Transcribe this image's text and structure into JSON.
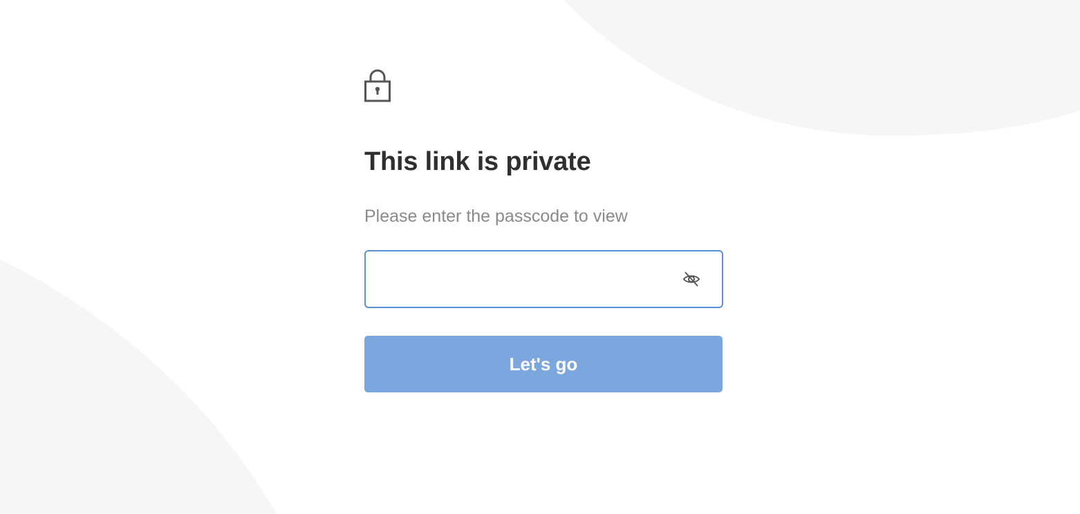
{
  "icons": {
    "lock": "lock-icon",
    "eye_toggle": "eye-slash-icon"
  },
  "colors": {
    "background": "#ffffff",
    "decor_shape": "#f6f6f6",
    "title": "#2f2f2f",
    "subtitle": "#8a8a8a",
    "input_border_focus": "#5b8fd6",
    "button_bg": "#7ca7de",
    "button_text": "#ffffff",
    "icon": "#555555"
  },
  "gate": {
    "title": "This link is private",
    "subtitle": "Please enter the passcode to view",
    "passcode_value": "",
    "submit_label": "Let's go"
  }
}
